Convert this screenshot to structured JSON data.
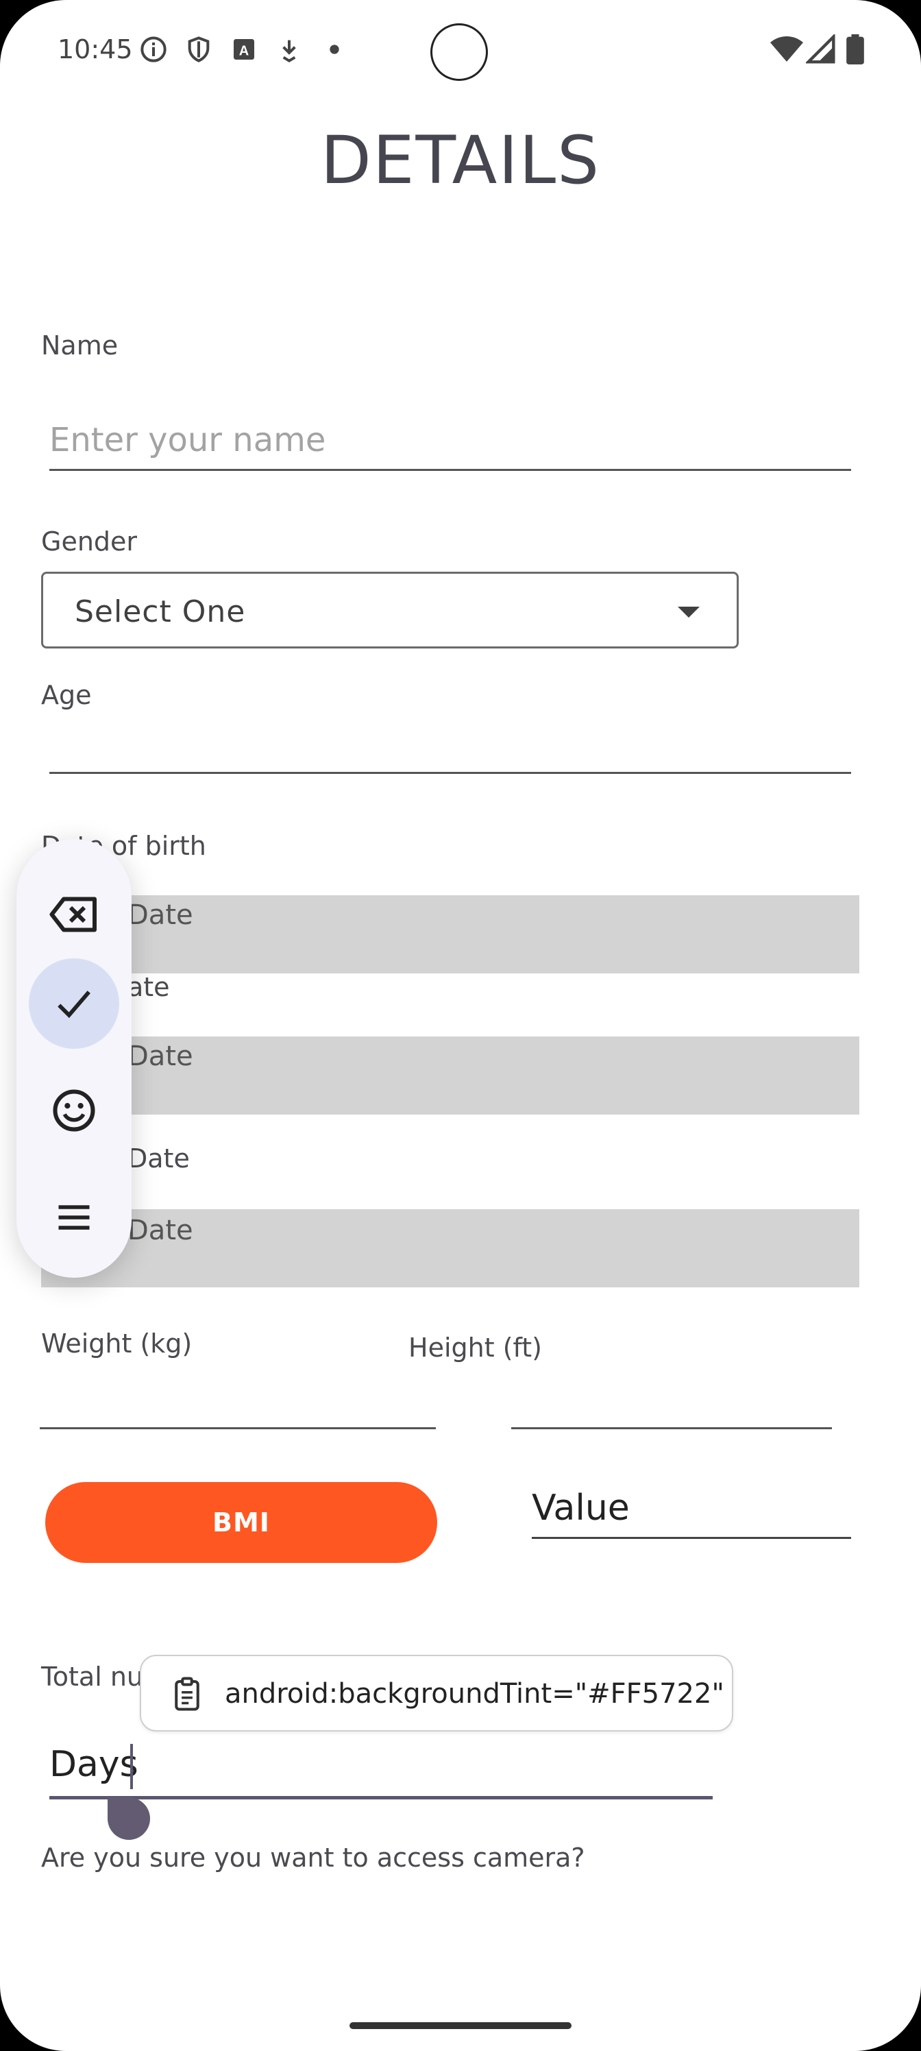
{
  "status_bar": {
    "time": "10:45",
    "icons": [
      "info-icon",
      "shield-icon",
      "text-a-icon",
      "download-arrow-icon",
      "dot-icon",
      "wifi-icon",
      "signal-icon",
      "battery-icon"
    ]
  },
  "page": {
    "title": "DETAILS"
  },
  "form": {
    "name_label": "Name",
    "name_placeholder": "Enter your name",
    "gender_label": "Gender",
    "gender_selected": "Select One",
    "age_label": "Age",
    "dob_label": "Date of birth",
    "dob_label_visible": "D",
    "dob_label_visible2": "e of birth",
    "date_box_1": "Date",
    "date_label_2": "ate",
    "date_box_2": "Date",
    "date_label_3": "Date",
    "date_box_3": "Date",
    "weight_label": "Weight (kg)",
    "height_label": "Height (ft)",
    "bmi_button": "BMI",
    "bmi_value": "Value",
    "total_label": "Total nu",
    "days_value": "Days",
    "camera_prompt": "Are you sure you want to access camera?"
  },
  "clipboard_suggestion": {
    "text": "android:backgroundTint=\"#FF5722\"",
    "icon": "clipboard-icon"
  },
  "floating_toolbar": {
    "buttons": [
      "backspace-icon",
      "check-icon",
      "emoji-icon",
      "menu-icon"
    ],
    "selected": "check-icon"
  },
  "colors": {
    "accent": "#FF5722",
    "date_box": "#d3d3d3",
    "toolbar_bg": "#f5f5fb",
    "toolbar_selected": "#d8dff5",
    "cursor_handle": "#625b71"
  }
}
